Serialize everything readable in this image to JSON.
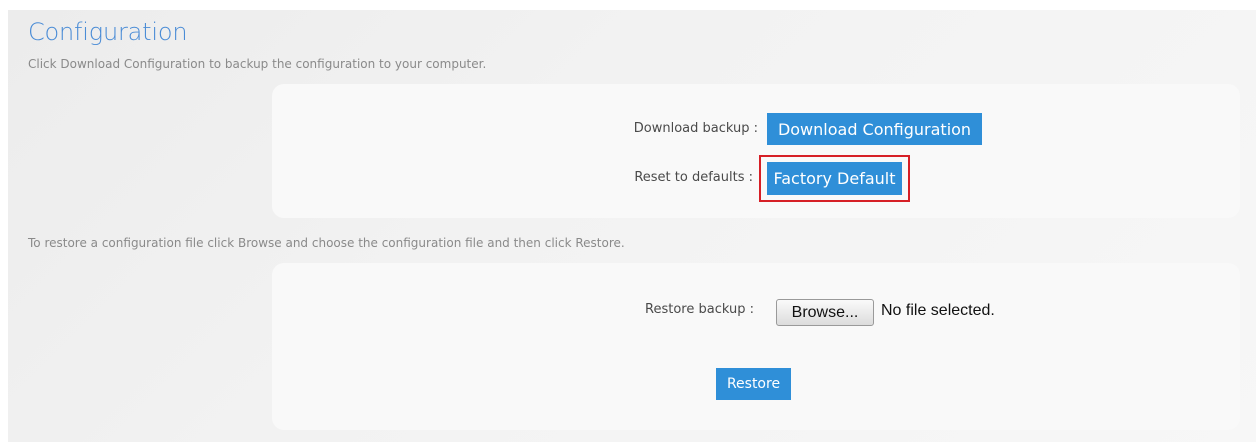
{
  "page": {
    "title": "Configuration",
    "description": "Click Download Configuration to backup the configuration to your computer.",
    "restore_description": "To restore a configuration file click Browse and choose the configuration file and then click Restore."
  },
  "backup_section": {
    "download_label": "Download backup :",
    "download_button": "Download Configuration",
    "reset_label": "Reset to defaults :",
    "reset_button": "Factory Default"
  },
  "restore_section": {
    "restore_label": "Restore backup :",
    "browse_button": "Browse...",
    "file_status": "No file selected.",
    "restore_button": "Restore"
  },
  "colors": {
    "accent": "#2f8fd8",
    "title": "#4a8cd6",
    "highlight": "#d61f26"
  }
}
